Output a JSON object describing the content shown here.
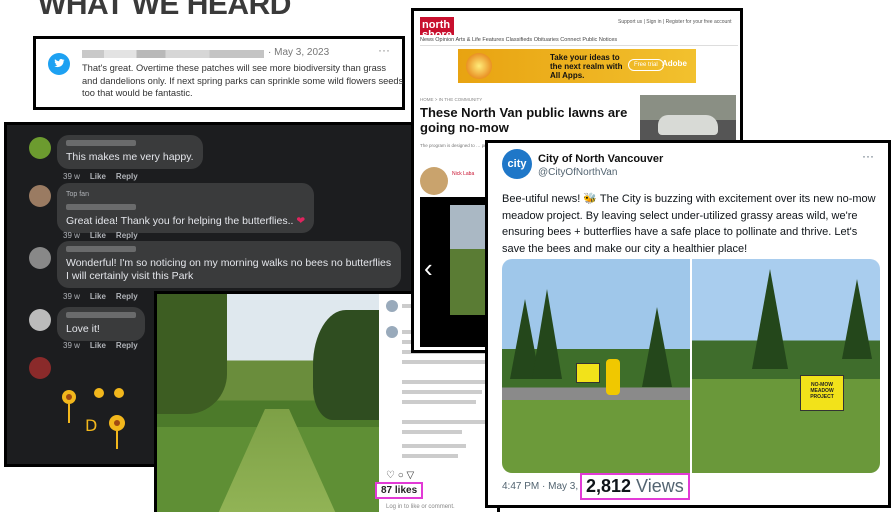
{
  "heading": "WHAT WE HEARD",
  "tweet_top": {
    "date": "· May 3, 2023",
    "more": "···",
    "text": "That's great. Overtime these patches will see more biodiversity than grass and dandelions only. If next spring parks can sprinkle some wild flowers seeds too that would be fantastic."
  },
  "facebook": {
    "comments": [
      {
        "text": "This makes me very happy.",
        "age": "39 w",
        "like": "Like",
        "reply": "Reply"
      },
      {
        "badge": "Top fan",
        "text": "Great idea! Thank you for helping the butterflies..",
        "age": "39 w",
        "like": "Like",
        "reply": "Reply"
      },
      {
        "text": "Wonderful! I'm so noticing on my morning walks no bees no butterflies I will certainly visit this Park",
        "age": "39 w",
        "like": "Like",
        "reply": "Reply"
      },
      {
        "text": "Love it!",
        "age": "39 w",
        "like": "Like",
        "reply": "Reply"
      }
    ],
    "heart": "❤",
    "emoji_art": "🌼☀🌼"
  },
  "instagram": {
    "likes": "87 likes",
    "actions": "♡ ○ ▽",
    "login": "Log in to like or comment."
  },
  "news": {
    "logo": "north shore news",
    "toplinks": "Support us | Sign in | Register for your free account",
    "nav": "News   Opinion   Arts & Life   Features   Classifieds   Obituaries   Connect   Public Notices",
    "ad_text": "Take your ideas to the next realm with All Apps.",
    "ad_button": "Free trial",
    "ad_brand": "Adobe",
    "crumb": "HOME > IN THE COMMUNITY",
    "headline": "These North Van public lawns are going no-mow",
    "subtext": "The program is designed to … production",
    "author": "Nick Laba"
  },
  "cnv_tweet": {
    "avatar_text": "city",
    "name": "City of North Vancouver",
    "handle": "@CityOfNorthVan",
    "more": "···",
    "text": "Bee-utiful news! 🐝 The City is buzzing with excitement over its new no-mow meadow project. By leaving select under-utilized grassy areas wild, we're ensuring bees + butterflies have a safe place to pollinate and thrive. Let's save the bees and make our city a healthier place!",
    "sign_text": "NO-MOW MEADOW PROJECT",
    "time": "4:47 PM · May 3,",
    "views_count": "2,812",
    "views_label": " Views"
  }
}
